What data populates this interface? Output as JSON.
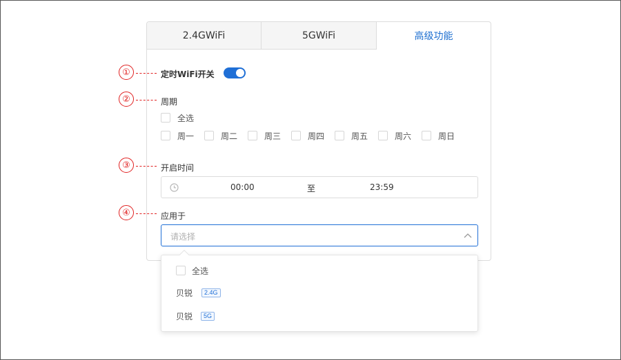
{
  "tabs": [
    {
      "label": "2.4GWiFi"
    },
    {
      "label": "5GWiFi"
    },
    {
      "label": "高级功能"
    }
  ],
  "timer_switch": {
    "label": "定时WiFi开关",
    "on": true
  },
  "period": {
    "label": "周期",
    "select_all": "全选",
    "days": [
      "周一",
      "周二",
      "周三",
      "周四",
      "周五",
      "周六",
      "周日"
    ]
  },
  "open_time": {
    "label": "开启时间",
    "start": "00:00",
    "separator": "至",
    "end": "23:59"
  },
  "apply_to": {
    "label": "应用于",
    "placeholder": "请选择"
  },
  "dropdown": {
    "select_all": "全选",
    "options": [
      {
        "name": "贝锐",
        "tag": "2.4G"
      },
      {
        "name": "贝锐",
        "tag": "5G"
      }
    ]
  },
  "markers": [
    "①",
    "②",
    "③",
    "④"
  ],
  "colors": {
    "accent": "#1f6fd6",
    "marker": "#e02020"
  }
}
